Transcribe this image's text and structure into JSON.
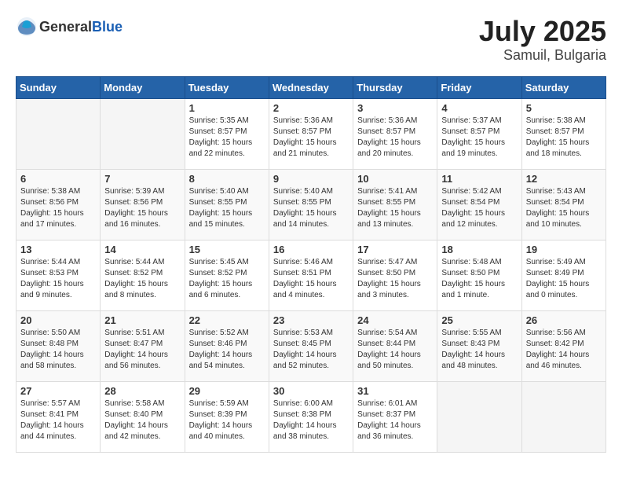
{
  "header": {
    "logo_general": "General",
    "logo_blue": "Blue",
    "month": "July 2025",
    "location": "Samuil, Bulgaria"
  },
  "weekdays": [
    "Sunday",
    "Monday",
    "Tuesday",
    "Wednesday",
    "Thursday",
    "Friday",
    "Saturday"
  ],
  "weeks": [
    [
      {
        "day": "",
        "info": ""
      },
      {
        "day": "",
        "info": ""
      },
      {
        "day": "1",
        "info": "Sunrise: 5:35 AM\nSunset: 8:57 PM\nDaylight: 15 hours\nand 22 minutes."
      },
      {
        "day": "2",
        "info": "Sunrise: 5:36 AM\nSunset: 8:57 PM\nDaylight: 15 hours\nand 21 minutes."
      },
      {
        "day": "3",
        "info": "Sunrise: 5:36 AM\nSunset: 8:57 PM\nDaylight: 15 hours\nand 20 minutes."
      },
      {
        "day": "4",
        "info": "Sunrise: 5:37 AM\nSunset: 8:57 PM\nDaylight: 15 hours\nand 19 minutes."
      },
      {
        "day": "5",
        "info": "Sunrise: 5:38 AM\nSunset: 8:57 PM\nDaylight: 15 hours\nand 18 minutes."
      }
    ],
    [
      {
        "day": "6",
        "info": "Sunrise: 5:38 AM\nSunset: 8:56 PM\nDaylight: 15 hours\nand 17 minutes."
      },
      {
        "day": "7",
        "info": "Sunrise: 5:39 AM\nSunset: 8:56 PM\nDaylight: 15 hours\nand 16 minutes."
      },
      {
        "day": "8",
        "info": "Sunrise: 5:40 AM\nSunset: 8:55 PM\nDaylight: 15 hours\nand 15 minutes."
      },
      {
        "day": "9",
        "info": "Sunrise: 5:40 AM\nSunset: 8:55 PM\nDaylight: 15 hours\nand 14 minutes."
      },
      {
        "day": "10",
        "info": "Sunrise: 5:41 AM\nSunset: 8:55 PM\nDaylight: 15 hours\nand 13 minutes."
      },
      {
        "day": "11",
        "info": "Sunrise: 5:42 AM\nSunset: 8:54 PM\nDaylight: 15 hours\nand 12 minutes."
      },
      {
        "day": "12",
        "info": "Sunrise: 5:43 AM\nSunset: 8:54 PM\nDaylight: 15 hours\nand 10 minutes."
      }
    ],
    [
      {
        "day": "13",
        "info": "Sunrise: 5:44 AM\nSunset: 8:53 PM\nDaylight: 15 hours\nand 9 minutes."
      },
      {
        "day": "14",
        "info": "Sunrise: 5:44 AM\nSunset: 8:52 PM\nDaylight: 15 hours\nand 8 minutes."
      },
      {
        "day": "15",
        "info": "Sunrise: 5:45 AM\nSunset: 8:52 PM\nDaylight: 15 hours\nand 6 minutes."
      },
      {
        "day": "16",
        "info": "Sunrise: 5:46 AM\nSunset: 8:51 PM\nDaylight: 15 hours\nand 4 minutes."
      },
      {
        "day": "17",
        "info": "Sunrise: 5:47 AM\nSunset: 8:50 PM\nDaylight: 15 hours\nand 3 minutes."
      },
      {
        "day": "18",
        "info": "Sunrise: 5:48 AM\nSunset: 8:50 PM\nDaylight: 15 hours\nand 1 minute."
      },
      {
        "day": "19",
        "info": "Sunrise: 5:49 AM\nSunset: 8:49 PM\nDaylight: 15 hours\nand 0 minutes."
      }
    ],
    [
      {
        "day": "20",
        "info": "Sunrise: 5:50 AM\nSunset: 8:48 PM\nDaylight: 14 hours\nand 58 minutes."
      },
      {
        "day": "21",
        "info": "Sunrise: 5:51 AM\nSunset: 8:47 PM\nDaylight: 14 hours\nand 56 minutes."
      },
      {
        "day": "22",
        "info": "Sunrise: 5:52 AM\nSunset: 8:46 PM\nDaylight: 14 hours\nand 54 minutes."
      },
      {
        "day": "23",
        "info": "Sunrise: 5:53 AM\nSunset: 8:45 PM\nDaylight: 14 hours\nand 52 minutes."
      },
      {
        "day": "24",
        "info": "Sunrise: 5:54 AM\nSunset: 8:44 PM\nDaylight: 14 hours\nand 50 minutes."
      },
      {
        "day": "25",
        "info": "Sunrise: 5:55 AM\nSunset: 8:43 PM\nDaylight: 14 hours\nand 48 minutes."
      },
      {
        "day": "26",
        "info": "Sunrise: 5:56 AM\nSunset: 8:42 PM\nDaylight: 14 hours\nand 46 minutes."
      }
    ],
    [
      {
        "day": "27",
        "info": "Sunrise: 5:57 AM\nSunset: 8:41 PM\nDaylight: 14 hours\nand 44 minutes."
      },
      {
        "day": "28",
        "info": "Sunrise: 5:58 AM\nSunset: 8:40 PM\nDaylight: 14 hours\nand 42 minutes."
      },
      {
        "day": "29",
        "info": "Sunrise: 5:59 AM\nSunset: 8:39 PM\nDaylight: 14 hours\nand 40 minutes."
      },
      {
        "day": "30",
        "info": "Sunrise: 6:00 AM\nSunset: 8:38 PM\nDaylight: 14 hours\nand 38 minutes."
      },
      {
        "day": "31",
        "info": "Sunrise: 6:01 AM\nSunset: 8:37 PM\nDaylight: 14 hours\nand 36 minutes."
      },
      {
        "day": "",
        "info": ""
      },
      {
        "day": "",
        "info": ""
      }
    ]
  ]
}
